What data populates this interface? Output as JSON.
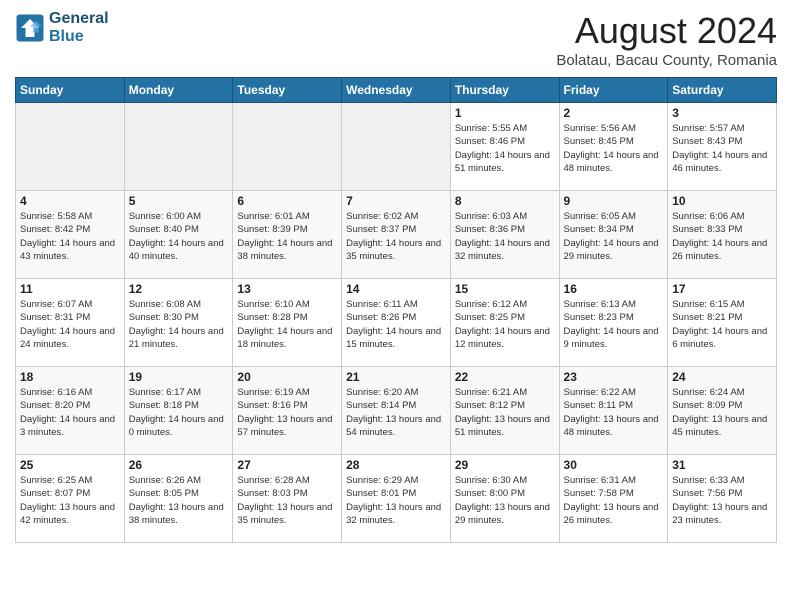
{
  "logo": {
    "line1": "General",
    "line2": "Blue"
  },
  "title": "August 2024",
  "location": "Bolatau, Bacau County, Romania",
  "days_of_week": [
    "Sunday",
    "Monday",
    "Tuesday",
    "Wednesday",
    "Thursday",
    "Friday",
    "Saturday"
  ],
  "weeks": [
    [
      {
        "num": "",
        "info": ""
      },
      {
        "num": "",
        "info": ""
      },
      {
        "num": "",
        "info": ""
      },
      {
        "num": "",
        "info": ""
      },
      {
        "num": "1",
        "info": "Sunrise: 5:55 AM\nSunset: 8:46 PM\nDaylight: 14 hours and 51 minutes."
      },
      {
        "num": "2",
        "info": "Sunrise: 5:56 AM\nSunset: 8:45 PM\nDaylight: 14 hours and 48 minutes."
      },
      {
        "num": "3",
        "info": "Sunrise: 5:57 AM\nSunset: 8:43 PM\nDaylight: 14 hours and 46 minutes."
      }
    ],
    [
      {
        "num": "4",
        "info": "Sunrise: 5:58 AM\nSunset: 8:42 PM\nDaylight: 14 hours and 43 minutes."
      },
      {
        "num": "5",
        "info": "Sunrise: 6:00 AM\nSunset: 8:40 PM\nDaylight: 14 hours and 40 minutes."
      },
      {
        "num": "6",
        "info": "Sunrise: 6:01 AM\nSunset: 8:39 PM\nDaylight: 14 hours and 38 minutes."
      },
      {
        "num": "7",
        "info": "Sunrise: 6:02 AM\nSunset: 8:37 PM\nDaylight: 14 hours and 35 minutes."
      },
      {
        "num": "8",
        "info": "Sunrise: 6:03 AM\nSunset: 8:36 PM\nDaylight: 14 hours and 32 minutes."
      },
      {
        "num": "9",
        "info": "Sunrise: 6:05 AM\nSunset: 8:34 PM\nDaylight: 14 hours and 29 minutes."
      },
      {
        "num": "10",
        "info": "Sunrise: 6:06 AM\nSunset: 8:33 PM\nDaylight: 14 hours and 26 minutes."
      }
    ],
    [
      {
        "num": "11",
        "info": "Sunrise: 6:07 AM\nSunset: 8:31 PM\nDaylight: 14 hours and 24 minutes."
      },
      {
        "num": "12",
        "info": "Sunrise: 6:08 AM\nSunset: 8:30 PM\nDaylight: 14 hours and 21 minutes."
      },
      {
        "num": "13",
        "info": "Sunrise: 6:10 AM\nSunset: 8:28 PM\nDaylight: 14 hours and 18 minutes."
      },
      {
        "num": "14",
        "info": "Sunrise: 6:11 AM\nSunset: 8:26 PM\nDaylight: 14 hours and 15 minutes."
      },
      {
        "num": "15",
        "info": "Sunrise: 6:12 AM\nSunset: 8:25 PM\nDaylight: 14 hours and 12 minutes."
      },
      {
        "num": "16",
        "info": "Sunrise: 6:13 AM\nSunset: 8:23 PM\nDaylight: 14 hours and 9 minutes."
      },
      {
        "num": "17",
        "info": "Sunrise: 6:15 AM\nSunset: 8:21 PM\nDaylight: 14 hours and 6 minutes."
      }
    ],
    [
      {
        "num": "18",
        "info": "Sunrise: 6:16 AM\nSunset: 8:20 PM\nDaylight: 14 hours and 3 minutes."
      },
      {
        "num": "19",
        "info": "Sunrise: 6:17 AM\nSunset: 8:18 PM\nDaylight: 14 hours and 0 minutes."
      },
      {
        "num": "20",
        "info": "Sunrise: 6:19 AM\nSunset: 8:16 PM\nDaylight: 13 hours and 57 minutes."
      },
      {
        "num": "21",
        "info": "Sunrise: 6:20 AM\nSunset: 8:14 PM\nDaylight: 13 hours and 54 minutes."
      },
      {
        "num": "22",
        "info": "Sunrise: 6:21 AM\nSunset: 8:12 PM\nDaylight: 13 hours and 51 minutes."
      },
      {
        "num": "23",
        "info": "Sunrise: 6:22 AM\nSunset: 8:11 PM\nDaylight: 13 hours and 48 minutes."
      },
      {
        "num": "24",
        "info": "Sunrise: 6:24 AM\nSunset: 8:09 PM\nDaylight: 13 hours and 45 minutes."
      }
    ],
    [
      {
        "num": "25",
        "info": "Sunrise: 6:25 AM\nSunset: 8:07 PM\nDaylight: 13 hours and 42 minutes."
      },
      {
        "num": "26",
        "info": "Sunrise: 6:26 AM\nSunset: 8:05 PM\nDaylight: 13 hours and 38 minutes."
      },
      {
        "num": "27",
        "info": "Sunrise: 6:28 AM\nSunset: 8:03 PM\nDaylight: 13 hours and 35 minutes."
      },
      {
        "num": "28",
        "info": "Sunrise: 6:29 AM\nSunset: 8:01 PM\nDaylight: 13 hours and 32 minutes."
      },
      {
        "num": "29",
        "info": "Sunrise: 6:30 AM\nSunset: 8:00 PM\nDaylight: 13 hours and 29 minutes."
      },
      {
        "num": "30",
        "info": "Sunrise: 6:31 AM\nSunset: 7:58 PM\nDaylight: 13 hours and 26 minutes."
      },
      {
        "num": "31",
        "info": "Sunrise: 6:33 AM\nSunset: 7:56 PM\nDaylight: 13 hours and 23 minutes."
      }
    ]
  ]
}
